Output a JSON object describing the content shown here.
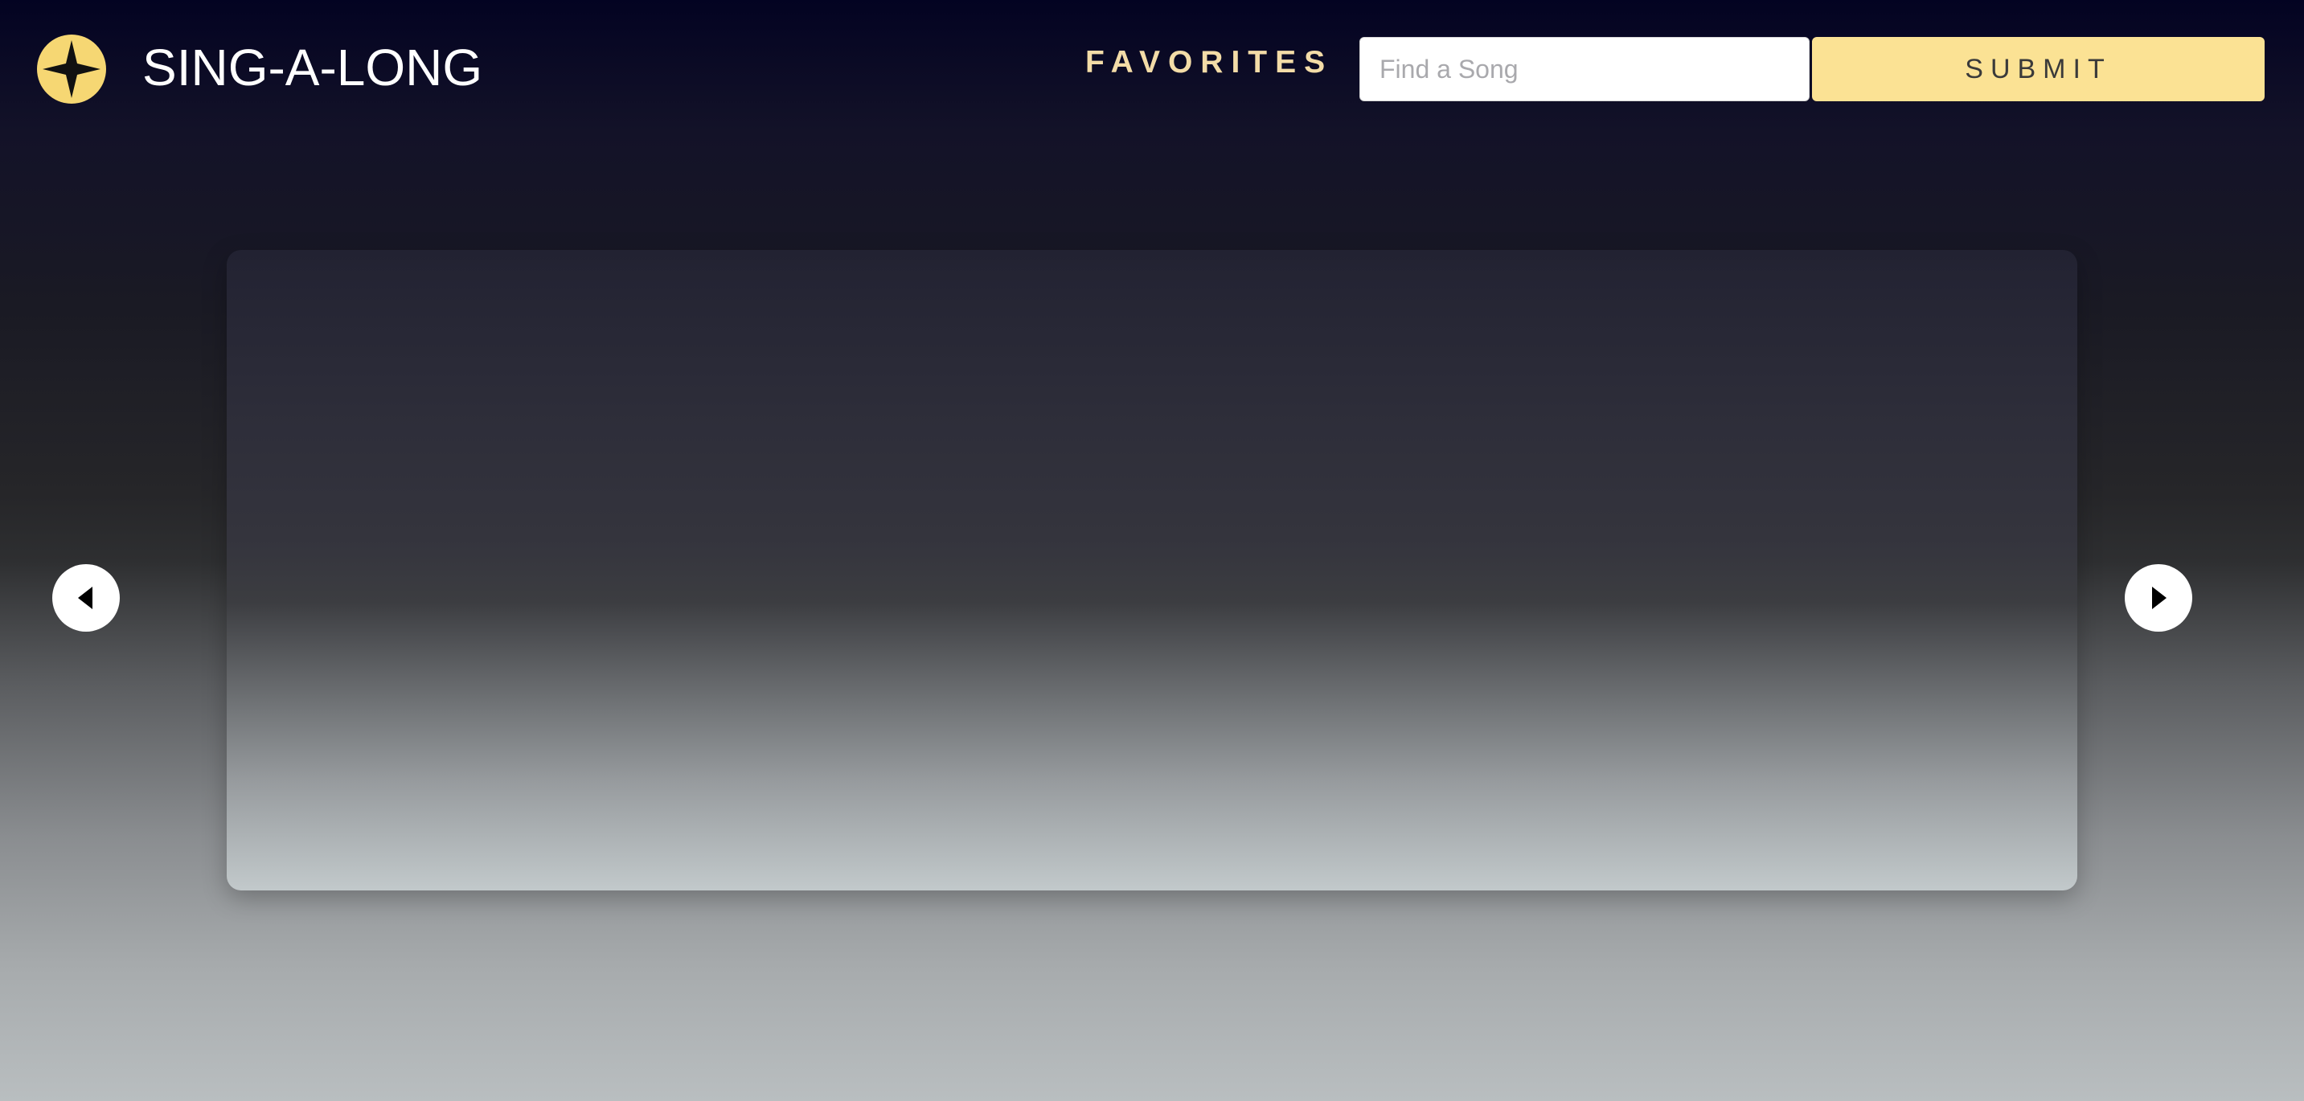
{
  "header": {
    "logo_icon": "four-point-star-icon",
    "brand_title": "SING-A-LONG",
    "favorites_label": "FAVORITES",
    "search": {
      "placeholder": "Find a Song",
      "value": ""
    },
    "submit_label": "SUBMIT"
  },
  "carousel": {
    "prev_icon": "caret-left-icon",
    "next_icon": "caret-right-icon"
  },
  "colors": {
    "accent_gold": "#f6d773",
    "submit_bg": "#fbe294",
    "favorites_text": "#f3dca7",
    "header_bg_top": "#030322"
  }
}
